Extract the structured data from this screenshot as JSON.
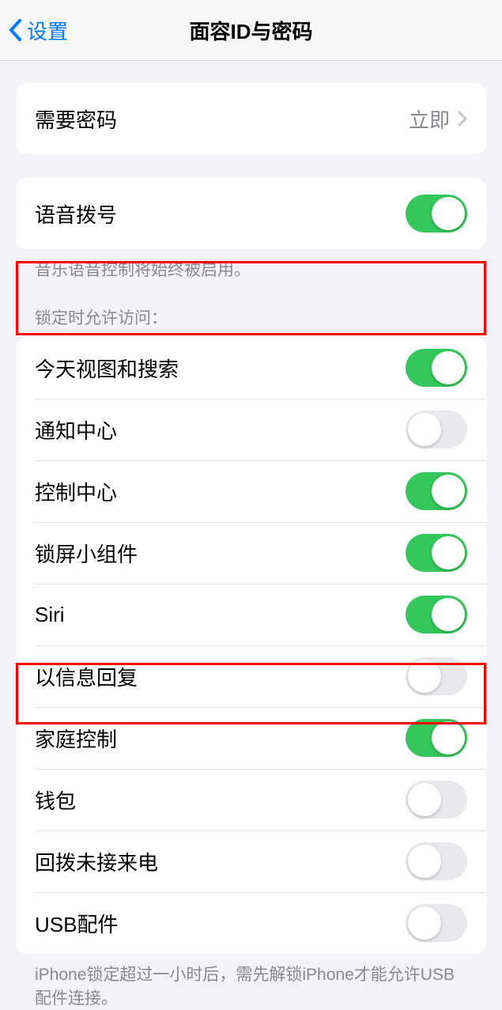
{
  "nav": {
    "back": "设置",
    "title": "面容ID与密码"
  },
  "passcode": {
    "label": "需要密码",
    "value": "立即"
  },
  "voiceDial": {
    "label": "语音拨号",
    "on": true,
    "footer": "音乐语音控制将始终被启用。"
  },
  "lockAccess": {
    "header": "锁定时允许访问：",
    "items": [
      {
        "label": "今天视图和搜索",
        "on": true
      },
      {
        "label": "通知中心",
        "on": false
      },
      {
        "label": "控制中心",
        "on": true
      },
      {
        "label": "锁屏小组件",
        "on": true
      },
      {
        "label": "Siri",
        "on": true
      },
      {
        "label": "以信息回复",
        "on": false
      },
      {
        "label": "家庭控制",
        "on": true
      },
      {
        "label": "钱包",
        "on": false
      },
      {
        "label": "回拨未接来电",
        "on": false
      },
      {
        "label": "USB配件",
        "on": false
      }
    ],
    "footer": "iPhone锁定超过一小时后，需先解锁iPhone才能允许USB配件连接。"
  }
}
